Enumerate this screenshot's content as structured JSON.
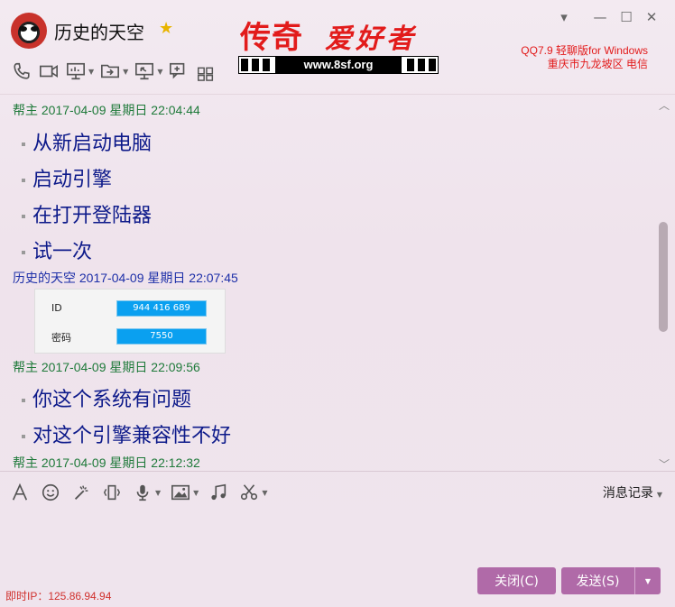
{
  "window": {
    "contact_name": "历史的天空",
    "brand_main": "传奇",
    "brand_sub": "爱好者",
    "site_url": "www.8sf.org",
    "version_line1": "QQ7.9 轻聊版for Windows",
    "version_line2": "重庆市九龙坡区 电信"
  },
  "messages": [
    {
      "sender": "帮主",
      "time": "2017-04-09 星期日 22:04:44",
      "lines": [
        "从新启动电脑",
        "启动引擎",
        "在打开登陆器",
        "试一次"
      ]
    },
    {
      "sender": "历史的天空",
      "time": "2017-04-09 星期日 22:07:45",
      "image": {
        "id_label": "ID",
        "id_value": "944 416 689",
        "pwd_label": "密码",
        "pwd_value": "7550"
      }
    },
    {
      "sender": "帮主",
      "time": "2017-04-09 星期日 22:09:56",
      "lines": [
        "你这个系统有问题",
        "对这个引擎兼容性不好"
      ]
    },
    {
      "sender": "帮主",
      "time": "2017-04-09 星期日 22:12:32"
    }
  ],
  "input": {
    "history_label": "消息记录"
  },
  "buttons": {
    "close_label": "关闭(C)",
    "send_label": "发送(S)"
  },
  "status": {
    "ip_text": "即时IP：125.86.94.94"
  }
}
